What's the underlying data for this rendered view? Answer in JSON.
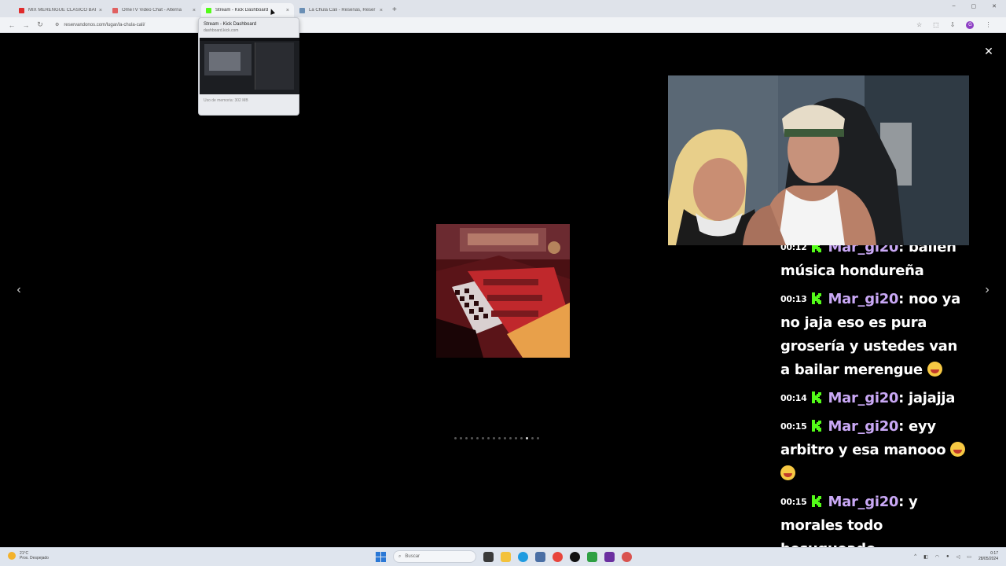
{
  "browser": {
    "tabs": [
      {
        "title": "MIX MERENGUE CLASICO BAI...",
        "fav_color": "#e02b2b",
        "active": false
      },
      {
        "title": "OmeTV Video Chat - Alterna",
        "fav_color": "#e06060",
        "active": false
      },
      {
        "title": "Stream - Kick Dashboard",
        "fav_color": "#53fc18",
        "active": true
      },
      {
        "title": "La Chula Cali - Reseñas, Reser",
        "fav_color": "#6a8fb5",
        "active": false
      }
    ],
    "new_tab": "+",
    "window_controls": [
      "–",
      "▢",
      "✕"
    ],
    "url": "reservandonos.com/lugar/la-chula-cali/",
    "profile_initial": "G"
  },
  "tab_preview": {
    "title": "Stream - Kick Dashboard",
    "domain": "dashboard.kick.com",
    "memory": "Uso de memoria: 302 MB"
  },
  "gallery": {
    "close": "✕",
    "prev": "‹",
    "next": "›",
    "dot_count": 16,
    "active_dot": 13
  },
  "chat": {
    "messages": [
      {
        "time": "00:12",
        "user": "Mar_gi20",
        "text": ": bailen música hondureña"
      },
      {
        "time": "00:13",
        "user": "Mar_gi20",
        "text": ": noo ya no jaja eso es pura grosería y ustedes van a bailar merengue",
        "emoji": 1
      },
      {
        "time": "00:14",
        "user": "Mar_gi20",
        "text": ": jajajja"
      },
      {
        "time": "00:15",
        "user": "Mar_gi20",
        "text": ": eyy arbitro y esa manooo",
        "emoji": 2
      },
      {
        "time": "00:15",
        "user": "Mar_gi20",
        "text": ": y morales todo besuqueado"
      }
    ],
    "kick_color": "#53fc18",
    "user_color": "#c9a8f5"
  },
  "taskbar": {
    "weather_temp": "21°C",
    "weather_desc": "Prox. Despejado",
    "search_placeholder": "Buscar",
    "time": "0:17",
    "date": "28/05/2024"
  }
}
